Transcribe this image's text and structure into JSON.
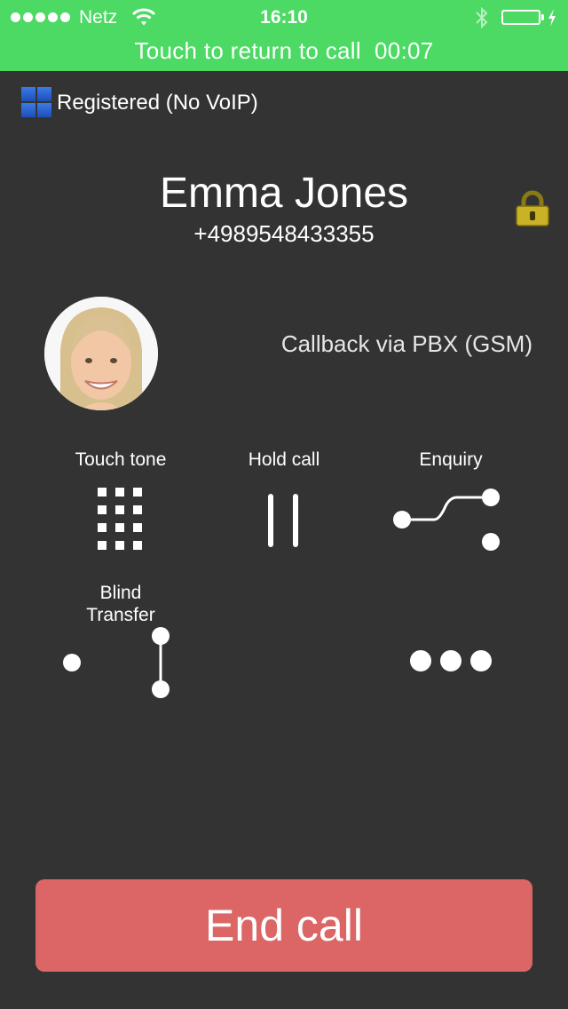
{
  "status_bar": {
    "carrier": "Netz",
    "time": "16:10",
    "return_call_text": "Touch to return to call",
    "call_duration": "00:07",
    "colors": {
      "bar": "#4cd964"
    }
  },
  "registration": {
    "text": "Registered (No VoIP)",
    "icon": "grid-icon"
  },
  "contact": {
    "name": "Emma Jones",
    "number": "+4989548433355",
    "secure_icon": "lock-icon",
    "call_mode": "Callback via PBX (GSM)"
  },
  "actions": [
    {
      "label": "Touch tone",
      "icon": "keypad-icon"
    },
    {
      "label": "Hold call",
      "icon": "pause-icon"
    },
    {
      "label": "Enquiry",
      "icon": "enquiry-icon"
    },
    {
      "label_line1": "Blind",
      "label_line2": "Transfer",
      "icon": "blind-transfer-icon"
    },
    {
      "label": "",
      "icon": "more-icon"
    }
  ],
  "end_call": {
    "label": "End call",
    "color": "#dc6565"
  }
}
